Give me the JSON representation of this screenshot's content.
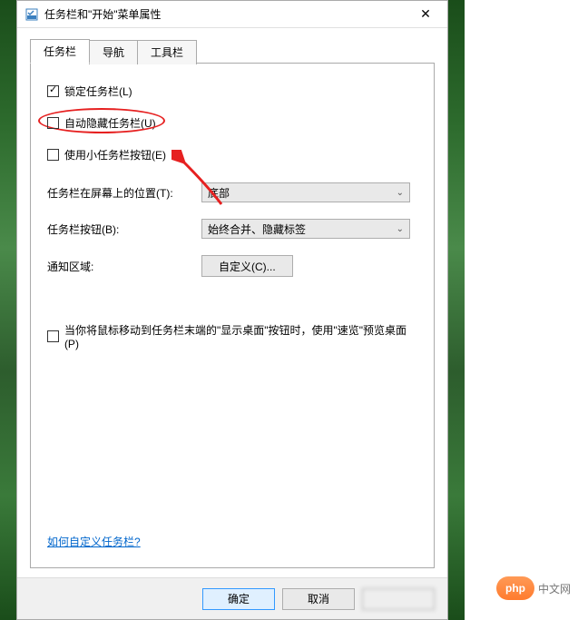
{
  "titlebar": {
    "title": "任务栏和\"开始\"菜单属性"
  },
  "tabs": [
    {
      "label": "任务栏",
      "active": true
    },
    {
      "label": "导航",
      "active": false
    },
    {
      "label": "工具栏",
      "active": false
    }
  ],
  "checkboxes": {
    "lock": {
      "label": "锁定任务栏(L)",
      "checked": true
    },
    "autohide": {
      "label": "自动隐藏任务栏(U)",
      "checked": false
    },
    "smallbuttons": {
      "label": "使用小任务栏按钮(E)",
      "checked": false
    },
    "preview": {
      "label": "当你将鼠标移动到任务栏末端的\"显示桌面\"按钮时，使用\"速览\"预览桌面(P)",
      "checked": false
    }
  },
  "fields": {
    "position": {
      "label": "任务栏在屏幕上的位置(T):",
      "value": "底部"
    },
    "buttons": {
      "label": "任务栏按钮(B):",
      "value": "始终合并、隐藏标签"
    },
    "notify": {
      "label": "通知区域:",
      "button": "自定义(C)..."
    }
  },
  "help_link": "如何自定义任务栏?",
  "footer": {
    "ok": "确定",
    "cancel": "取消"
  },
  "watermark": {
    "logo": "php",
    "text": "中文网"
  }
}
